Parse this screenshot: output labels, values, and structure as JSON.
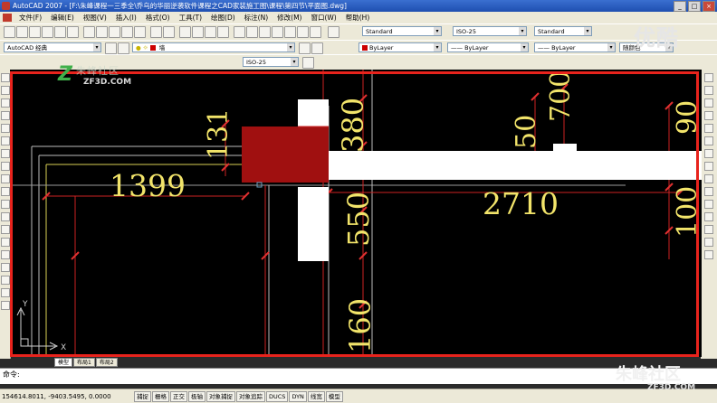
{
  "window": {
    "title": "AutoCAD 2007 - [F:\\朱峰课程一三季全\\乔乌的华丽逆袭软件课程之CAD家装施工图\\课程\\第四节\\平面图.dwg]",
    "min": "_",
    "max": "□",
    "close": "×"
  },
  "menu": [
    "文件(F)",
    "编辑(E)",
    "视图(V)",
    "插入(I)",
    "格式(O)",
    "工具(T)",
    "绘图(D)",
    "标注(N)",
    "修改(M)",
    "窗口(W)",
    "帮助(H)"
  ],
  "toolbar": {
    "text_style": "Standard",
    "dim_style": "ISO-25",
    "table_style": "Standard",
    "workspace": "AutoCAD 经典",
    "layer": "墙",
    "dim_style2": "ISO-25",
    "color": "ByLayer",
    "linetype": "ByLayer",
    "lineweight": "ByLayer",
    "plotstyle": "随颜色"
  },
  "watermark": {
    "top_right": "优酷",
    "site": "ZF3D.COM",
    "site_cn": "朱峰社区",
    "bottom": "朱峰社区",
    "bottom_sub": "ZF3D.COM"
  },
  "drawing": {
    "dims": [
      "131",
      "1399",
      "380",
      "550",
      "160",
      "50",
      "700",
      "2710",
      "90",
      "100"
    ],
    "colors": {
      "background": "#000000",
      "dim_text": "#f2e46a",
      "dim_line": "#cc2222",
      "wall_fill": "#ffffff",
      "column_fill": "#a01010",
      "frame": "#e8231c"
    }
  },
  "ucs": {
    "x": "X",
    "y": "Y"
  },
  "tabs": [
    "模型",
    "布局1",
    "布局2"
  ],
  "command": {
    "prompt": "命令:"
  },
  "status": {
    "coords": "154614.8011, -9403.5495, 0.0000",
    "buttons": [
      "捕捉",
      "栅格",
      "正交",
      "极轴",
      "对象捕捉",
      "对象追踪",
      "DUCS",
      "DYN",
      "线宽",
      "模型"
    ]
  }
}
